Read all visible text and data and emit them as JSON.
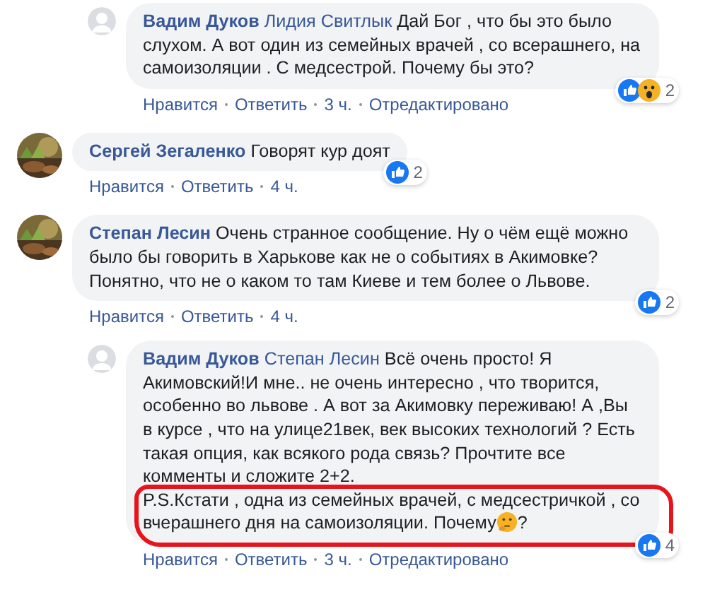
{
  "comments": [
    {
      "kind": "reply",
      "avatar": {
        "kind": "default"
      },
      "author": "Вадим Дуков",
      "mention": "Лидия Свитлык",
      "text": "Дай Бог , что бы это было слухом. А вот один из семейных врачей , со всерашнего, на самоизоляции . С медсестрой. Почему бы это?",
      "reactions": [
        {
          "kind": "like"
        },
        {
          "kind": "wow"
        }
      ],
      "reaction_count": "2",
      "actions": [
        "Нравится",
        "Ответить",
        "3 ч.",
        "Отредактировано"
      ]
    },
    {
      "kind": "top",
      "avatar": {
        "kind": "picture"
      },
      "author": "Сергей Зегаленко",
      "text": "Говорят кур доят",
      "reactions": [
        {
          "kind": "like"
        }
      ],
      "reaction_count": "2",
      "actions": [
        "Нравится",
        "Ответить",
        "4 ч."
      ]
    },
    {
      "kind": "top",
      "avatar": {
        "kind": "picture"
      },
      "author": "Степан Лесин",
      "text": "Очень странное сообщение. Ну о чём ещё можно было бы говорить в Харькове как не о событиях в Акимовке? Понятно, что не о каком то там Киеве и тем более о Львове.",
      "reactions": [
        {
          "kind": "like"
        }
      ],
      "reaction_count": "2",
      "actions": [
        "Нравится",
        "Ответить",
        "4 ч."
      ]
    },
    {
      "kind": "reply",
      "avatar": {
        "kind": "default"
      },
      "author": "Вадим Дуков",
      "mention": "Степан Лесин",
      "text": "Всё очень просто! Я Акимовский!И мне.. не очень интересно , что творится, особенно во львове . А вот за Акимовку переживаю! А ,Вы в курсе , что на улице21век, век высоких технологий ? Есть такая опция, как всякого рода связь? Прочтите все комменты и сложите 2+2.",
      "ps": {
        "text": "P.S.Кстати , одна из семейных врачей, с медсестричкой , со вчерашнего дня на самоизоляции. Почему",
        "emoji": {
          "kind": "thinking"
        },
        "end": "?",
        "circled": true
      },
      "reactions": [
        {
          "kind": "like"
        }
      ],
      "reaction_count": "4",
      "actions": [
        "Нравится",
        "Ответить",
        "3 ч.",
        "Отредактировано"
      ]
    }
  ]
}
